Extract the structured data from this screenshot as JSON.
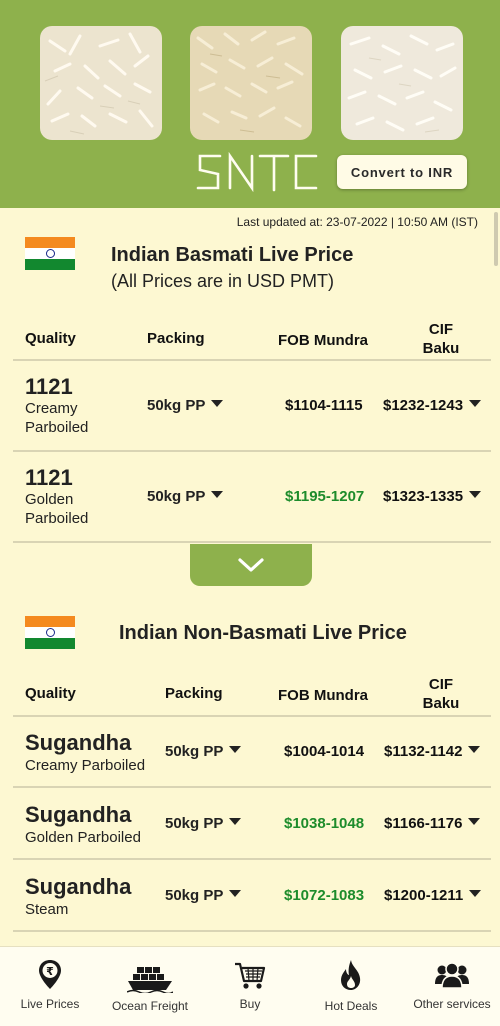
{
  "header": {
    "logo_text": "SNTC",
    "convert_button": "Convert to INR",
    "bg_color": "#8eb14c"
  },
  "last_updated": "Last updated at: 23-07-2022 | 10:50 AM (IST)",
  "basmati": {
    "title": "Indian Basmati Live Price",
    "subtitle": "(All Prices are in USD PMT)",
    "columns": {
      "quality": "Quality",
      "packing": "Packing",
      "fob": "FOB Mundra",
      "cif_line1": "CIF",
      "cif_line2": "Baku"
    },
    "rows": [
      {
        "quality_main": "1121",
        "quality_line1": "Creamy",
        "quality_line2": "Parboiled",
        "packing": "50kg PP",
        "fob": "$1104-1115",
        "fob_color": "#111111",
        "cif": "$1232-1243"
      },
      {
        "quality_main": "1121",
        "quality_line1": "Golden",
        "quality_line2": "Parboiled",
        "packing": "50kg PP",
        "fob": "$1195-1207",
        "fob_color": "#1d8c2b",
        "cif": "$1323-1335"
      }
    ]
  },
  "non_basmati": {
    "title": "Indian Non-Basmati Live Price",
    "columns": {
      "quality": "Quality",
      "packing": "Packing",
      "fob": "FOB Mundra",
      "cif_line1": "CIF",
      "cif_line2": "Baku"
    },
    "rows": [
      {
        "quality_main": "Sugandha",
        "quality_sub": "Creamy Parboiled",
        "packing": "50kg PP",
        "fob": "$1004-1014",
        "fob_color": "#111111",
        "cif": "$1132-1142"
      },
      {
        "quality_main": "Sugandha",
        "quality_sub": "Golden Parboiled",
        "packing": "50kg PP",
        "fob": "$1038-1048",
        "fob_color": "#1d8c2b",
        "cif": "$1166-1176"
      },
      {
        "quality_main": "Sugandha",
        "quality_sub": "Steam",
        "packing": "50kg PP",
        "fob": "$1072-1083",
        "fob_color": "#1d8c2b",
        "cif": "$1200-1211"
      }
    ]
  },
  "bottom_nav": {
    "items": [
      {
        "label": "Live Prices",
        "icon": "rupee-location-icon"
      },
      {
        "label": "Ocean Freight",
        "icon": "ship-icon"
      },
      {
        "label": "Buy",
        "icon": "cart-icon"
      },
      {
        "label": "Hot Deals",
        "icon": "fire-icon"
      },
      {
        "label": "Other services",
        "icon": "users-icon"
      }
    ]
  }
}
